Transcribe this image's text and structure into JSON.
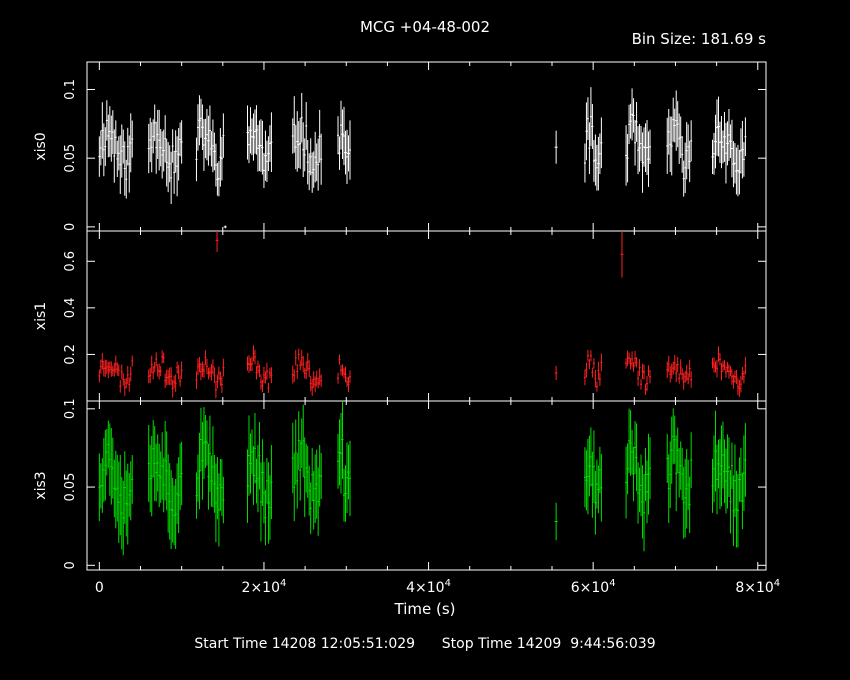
{
  "chart_data": {
    "type": "scatter",
    "title": "MCG +04-48-002",
    "bin_size_label": "Bin Size: 181.69 s",
    "xlabel": "Time (s)",
    "xlim": [
      -1500,
      81000
    ],
    "x_ticks": [
      0,
      20000,
      40000,
      60000,
      80000
    ],
    "x_tick_labels": [
      {
        "mant": "0",
        "exp": ""
      },
      {
        "mant": "2×10",
        "exp": "4"
      },
      {
        "mant": "4×10",
        "exp": "4"
      },
      {
        "mant": "6×10",
        "exp": "4"
      },
      {
        "mant": "8×10",
        "exp": "4"
      }
    ],
    "segments": [
      [
        0,
        4000
      ],
      [
        6000,
        10000
      ],
      [
        11800,
        15200
      ],
      [
        18000,
        21000
      ],
      [
        23500,
        27000
      ],
      [
        29000,
        30500
      ],
      [
        59000,
        61000
      ],
      [
        64000,
        67000
      ],
      [
        69000,
        72000
      ],
      [
        74500,
        78500
      ]
    ],
    "panels": [
      {
        "name": "xis0",
        "ylabel": "xis0",
        "color": "#ffffff",
        "ylim": [
          -0.003,
          0.12
        ],
        "y_ticks": [
          0,
          0.05,
          0.1
        ],
        "y_tick_labels": [
          "0",
          "0.05",
          "0.1"
        ],
        "base": 0.058,
        "amp": 0.012,
        "err": 0.017,
        "extras": [
          {
            "x": 55500,
            "y": 0.058,
            "err": 0.012
          },
          {
            "x": 15300,
            "y": 0.0,
            "err": 0.001
          }
        ],
        "seed": 11
      },
      {
        "name": "xis1",
        "ylabel": "xis1",
        "color": "#ff2020",
        "ylim": [
          0,
          0.73
        ],
        "y_ticks": [
          0.2,
          0.4,
          0.6
        ],
        "y_tick_labels": [
          "0.2",
          "0.4",
          "0.6"
        ],
        "base": 0.13,
        "amp": 0.04,
        "err": 0.03,
        "extras": [
          {
            "x": 14300,
            "y": 0.69,
            "err": 0.05
          },
          {
            "x": 63500,
            "y": 0.63,
            "err": 0.1
          },
          {
            "x": 55500,
            "y": 0.12,
            "err": 0.03
          }
        ],
        "seed": 23
      },
      {
        "name": "xis3",
        "ylabel": "xis3",
        "color": "#00e000",
        "ylim": [
          -0.003,
          0.105
        ],
        "y_ticks": [
          0,
          0.05,
          0.1
        ],
        "y_tick_labels": [
          "0",
          "0.05",
          "0.1"
        ],
        "base": 0.057,
        "amp": 0.013,
        "err": 0.02,
        "extras": [
          {
            "x": 55500,
            "y": 0.028,
            "err": 0.012
          }
        ],
        "seed": 37
      }
    ]
  },
  "footer": {
    "start": "Start Time 14208 12:05:51:029",
    "stop": "Stop Time 14209  9:44:56:039"
  }
}
